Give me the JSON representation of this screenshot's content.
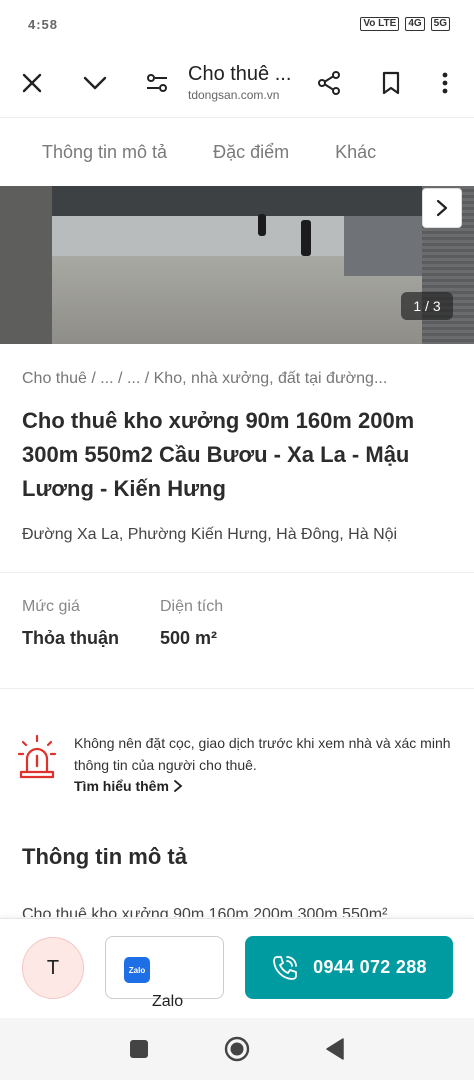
{
  "status_bar": {
    "time": "4:58",
    "net_badges": [
      "Vo LTE",
      "4G",
      "5G"
    ]
  },
  "header": {
    "title": "Cho thuê ...",
    "domain": "tdongsan.com.vn"
  },
  "tabs": [
    {
      "label": "Thông tin mô tả"
    },
    {
      "label": "Đặc điểm"
    },
    {
      "label": "Khác"
    }
  ],
  "gallery": {
    "counter": "1 / 3"
  },
  "listing": {
    "breadcrumb": "Cho thuê / ... / ... / Kho, nhà xưởng, đất tại đường...",
    "title": "Cho thuê kho xưởng 90m 160m 200m 300m 550m2 Cầu Bươu - Xa La - Mậu Lương - Kiến Hưng",
    "address": "Đường Xa La, Phường Kiến Hưng, Hà Đông, Hà Nội"
  },
  "specs": {
    "price_label": "Mức giá",
    "price_value": "Thỏa thuận",
    "area_label": "Diện tích",
    "area_value": "500 m²"
  },
  "warning": {
    "text": "Không nên đặt cọc, giao dịch trước khi xem nhà và xác minh thông tin của người cho thuê.",
    "link": "Tìm hiểu thêm"
  },
  "description": {
    "section_title": "Thông tin mô tả",
    "preview": "Cho thuê kho xưởng 90m 160m 200m 300m 550m²"
  },
  "contact": {
    "avatar_initial": "T",
    "zalo_logo_text": "Zalo",
    "zalo_label": "Zalo",
    "phone": "0944 072 288"
  },
  "colors": {
    "primary": "#009ba1",
    "warning": "#e0312a",
    "zalo": "#1e6fe6"
  }
}
